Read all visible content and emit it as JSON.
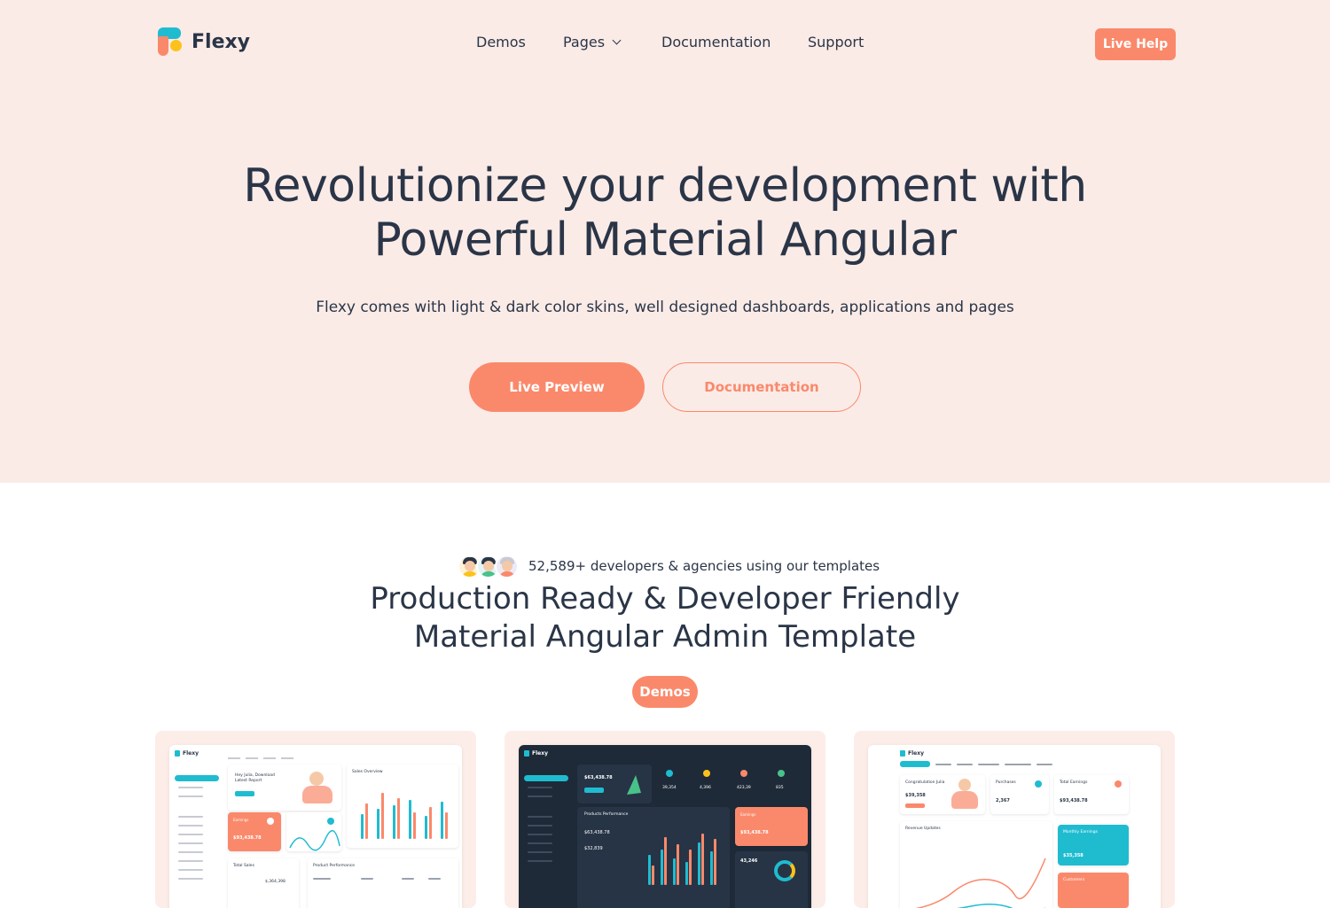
{
  "brand": {
    "name": "Flexy"
  },
  "nav": {
    "items": [
      {
        "label": "Demos"
      },
      {
        "label": "Pages"
      },
      {
        "label": "Documentation"
      },
      {
        "label": "Support"
      }
    ],
    "cta_label": "Live Help"
  },
  "hero": {
    "title_line1": "Revolutionize your development with",
    "title_line2": "Powerful Material Angular",
    "subtitle": "Flexy comes with light & dark color skins, well designed dashboards, applications and pages",
    "primary_button": "Live Preview",
    "secondary_button": "Documentation"
  },
  "section": {
    "developers": "52,589+ developers & agencies using our templates",
    "title_line1": "Production Ready & Developer Friendly",
    "title_line2": "Material Angular Admin Template",
    "badge": "Demos"
  },
  "demo_cards": [
    {
      "theme": "light",
      "logo": "Flexy",
      "greeting": "Hey Julia, Download Latest Report",
      "chart_title": "Sales Overview",
      "earnings_label": "Earnings",
      "earnings_value": "$93,438.78",
      "total_sales_label": "Total Sales",
      "total_sales_value": "$,364,398",
      "table_title": "Product Performance"
    },
    {
      "theme": "dark",
      "logo": "Flexy",
      "earnings_value": "$63,438.78",
      "chart_title": "Products Performance",
      "stat1": "39,354",
      "stat2": "4,396",
      "stat3": "423,39",
      "stat4": "835",
      "side_value": "$93,438.78",
      "side_label": "Earnings",
      "total": "43,246",
      "metric1": "$63,438.78",
      "metric2": "$32,839"
    },
    {
      "theme": "light",
      "logo": "Flexy",
      "greeting": "Congratulation Julia",
      "greeting_value": "$39,358",
      "purchases_label": "Purchases",
      "purchases_value": "2,367",
      "earnings_label": "Total Earnings",
      "earnings_value": "$93,438.78",
      "chart_title": "Revenue Updates",
      "monthly_label": "Monthly Earnings",
      "monthly_value": "$35,358",
      "customers_label": "Customers"
    }
  ],
  "colors": {
    "accent": "#fa896b",
    "teal": "#1fbcd0",
    "text": "#2a3547",
    "hero_bg": "#fbebe7"
  }
}
